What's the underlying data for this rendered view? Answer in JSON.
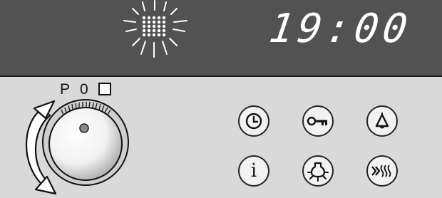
{
  "display": {
    "time": "19:00"
  },
  "function_selector": {
    "positions": [
      "P",
      "0"
    ],
    "off_symbol": "square-outline-icon"
  },
  "buttons": [
    {
      "name": "clock-button",
      "icon": "clock-icon"
    },
    {
      "name": "key-lock-button",
      "icon": "key-icon"
    },
    {
      "name": "alarm-button",
      "icon": "bell-icon"
    },
    {
      "name": "info-button",
      "icon": "info-icon",
      "label": "i"
    },
    {
      "name": "oven-light-button",
      "icon": "oven-light-icon"
    },
    {
      "name": "rapid-heat-button",
      "icon": "rapid-heat-icon"
    }
  ],
  "colors": {
    "display_background": "#525252",
    "control_surface": "#d9d9d9",
    "display_text": "#ffffff"
  }
}
